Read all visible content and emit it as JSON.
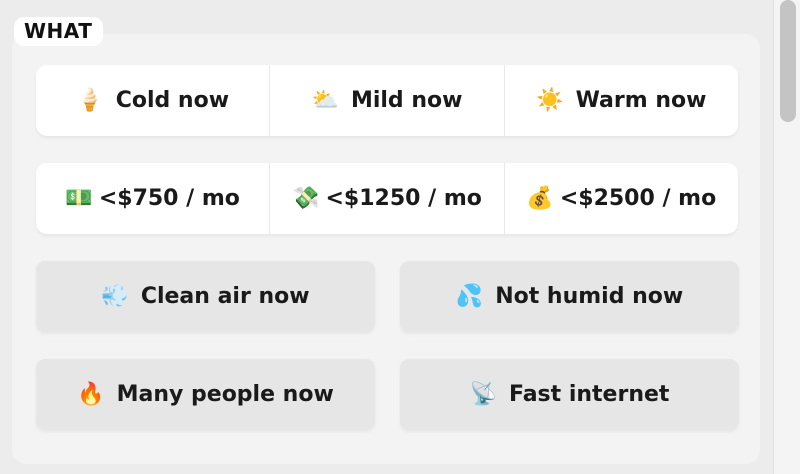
{
  "section_label": "WHAT",
  "climate_row": [
    {
      "icon": "ice-cream-icon",
      "glyph": "🍦",
      "label": "Cold now"
    },
    {
      "icon": "sun-behind-cloud-icon",
      "glyph": "⛅",
      "label": "Mild now"
    },
    {
      "icon": "sun-icon",
      "glyph": "☀️",
      "label": "Warm now"
    }
  ],
  "cost_row": [
    {
      "icon": "banknote-icon",
      "glyph": "💵",
      "label": "<$750 / mo"
    },
    {
      "icon": "money-with-wings-icon",
      "glyph": "💸",
      "label": "<$1250 / mo"
    },
    {
      "icon": "money-bag-icon",
      "glyph": "💰",
      "label": "<$2500 / mo"
    }
  ],
  "cards": [
    {
      "icon": "wind-face-icon",
      "glyph": "💨",
      "label": "Clean air now"
    },
    {
      "icon": "water-drops-icon",
      "glyph": "💦",
      "label": "Not humid now"
    },
    {
      "icon": "fire-icon",
      "glyph": "🔥",
      "label": "Many people now"
    },
    {
      "icon": "satellite-dish-icon",
      "glyph": "📡",
      "label": "Fast internet"
    }
  ]
}
